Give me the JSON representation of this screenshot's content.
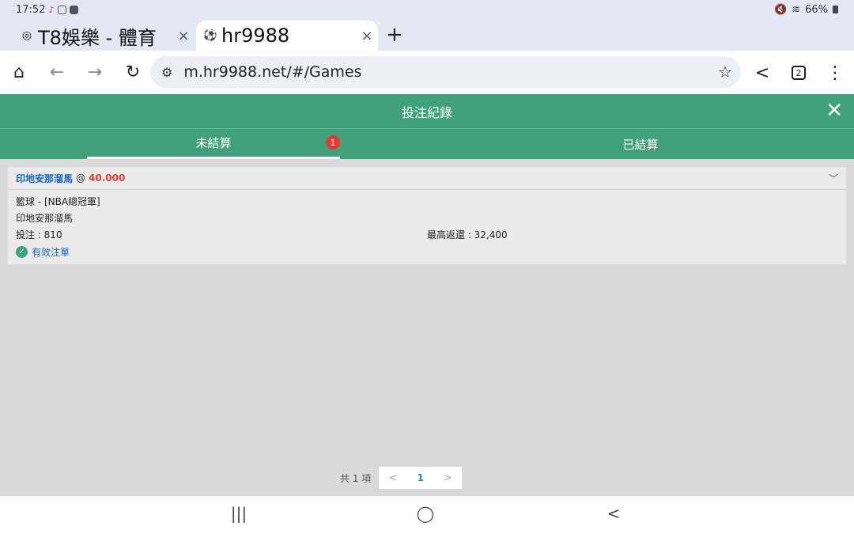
{
  "status_bar": {
    "time": "17:52",
    "battery_text": "66%"
  },
  "browser": {
    "tabs": [
      {
        "title": "T8娛樂 - 體育",
        "favicon": "◎",
        "close": "×"
      },
      {
        "title": "hr9988",
        "favicon": "⚽",
        "close": "×"
      }
    ],
    "new_tab_label": "+",
    "url": "m.hr9988.net/#/Games",
    "open_tabs_count": "2"
  },
  "app": {
    "title": "投注紀錄",
    "tabs": [
      {
        "label": "未結算",
        "badge": "1"
      },
      {
        "label": "已結算"
      }
    ],
    "bets": [
      {
        "selection": "印地安那溜馬",
        "at": "@",
        "odds": "40.000",
        "market": "籃球 - [NBA總冠軍]",
        "team": "印地安那溜馬",
        "stake": "投注 : 810",
        "max_return": "最高返還 : 32,400",
        "status": "有效注單"
      }
    ],
    "pagination": {
      "total": "共 1 項",
      "prev": "<",
      "current": "1",
      "next": ">"
    }
  }
}
